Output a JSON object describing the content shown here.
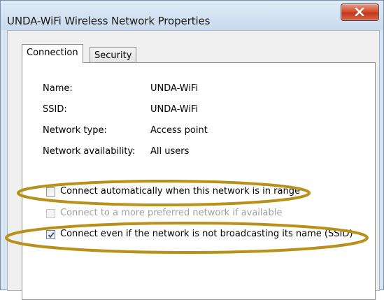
{
  "window": {
    "title": "UNDA-WiFi Wireless Network Properties"
  },
  "tabs": [
    {
      "label": "Connection",
      "selected": true
    },
    {
      "label": "Security",
      "selected": false
    }
  ],
  "properties": [
    {
      "label": "Name:",
      "value": "UNDA-WiFi"
    },
    {
      "label": "SSID:",
      "value": "UNDA-WiFi"
    },
    {
      "label": "Network type:",
      "value": "Access point"
    },
    {
      "label": "Network availability:",
      "value": "All users"
    }
  ],
  "options": [
    {
      "label": "Connect automatically when this network is in range",
      "checked": false,
      "enabled": true
    },
    {
      "label": "Connect to a more preferred network if available",
      "checked": false,
      "enabled": false
    },
    {
      "label": "Connect even if the network is not broadcasting its name (SSID)",
      "checked": true,
      "enabled": true
    }
  ],
  "colors": {
    "highlight_oval": "#b8901a",
    "close_button": "#c4381a",
    "window_frame": "#d7e4f2"
  },
  "icons": {
    "close": "close-icon",
    "checkmark": "checkmark-icon"
  }
}
